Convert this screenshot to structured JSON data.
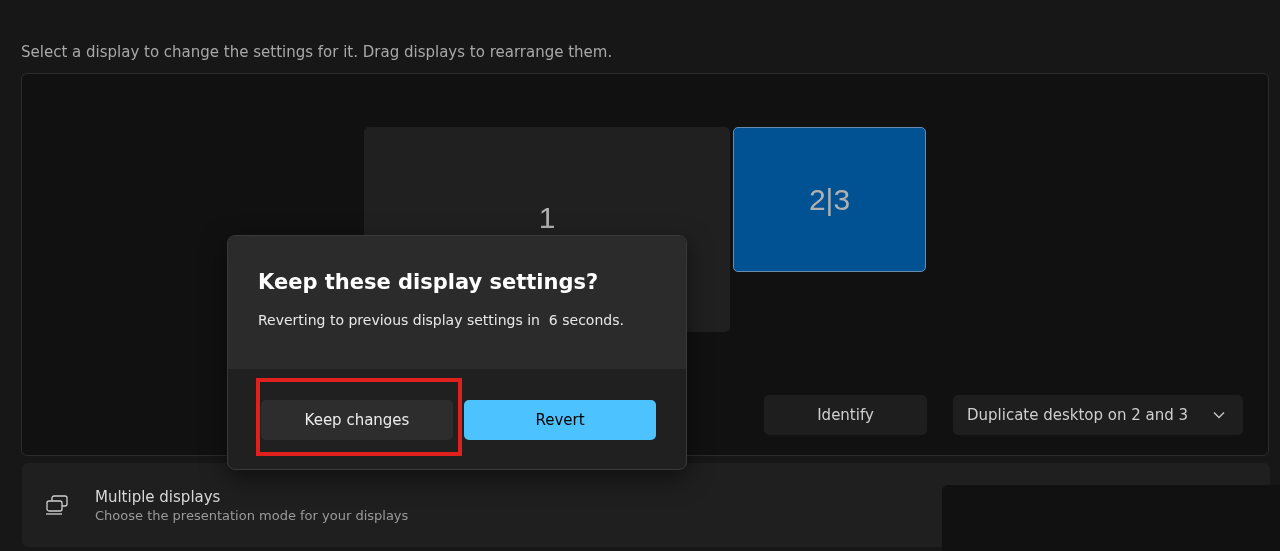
{
  "instruction": "Select a display to change the settings for it. Drag displays to rearrange them.",
  "displays": [
    {
      "label": "1",
      "selected": false
    },
    {
      "label": "2|3",
      "selected": true
    }
  ],
  "arrangement_buttons": {
    "identify": "Identify",
    "mode_dropdown": {
      "value": "Duplicate desktop on 2 and 3"
    }
  },
  "dialog": {
    "title": "Keep these display settings?",
    "message": "Reverting to previous display settings in  6 seconds.",
    "buttons": [
      {
        "label": "Keep changes",
        "kind": "secondary",
        "highlighted": true
      },
      {
        "label": "Revert",
        "kind": "primary",
        "highlighted": false
      }
    ]
  },
  "multiple_displays": {
    "title": "Multiple displays",
    "subtitle": "Choose the presentation mode for your displays"
  }
}
